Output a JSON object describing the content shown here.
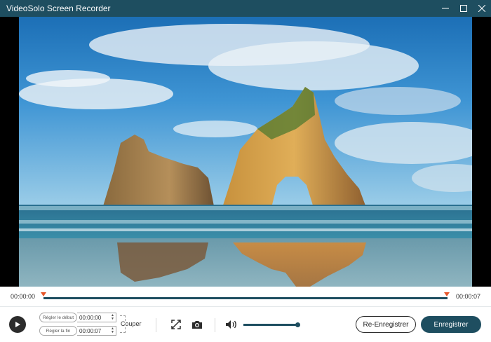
{
  "window": {
    "title": "VideoSolo Screen Recorder",
    "controls": [
      "minimize-icon",
      "maximize-icon",
      "close-icon"
    ]
  },
  "timeline": {
    "start_time": "00:00:00",
    "end_time": "00:00:07"
  },
  "trim": {
    "start_label": "Régler le début",
    "start_value": "00:00:00",
    "end_label": "Régler la fin",
    "end_value": "00:00:07",
    "cut_label": "Couper"
  },
  "toolbar": {
    "icons": [
      "play-icon",
      "fullscreen-icon",
      "camera-icon",
      "volume-icon"
    ],
    "volume_level": 1.0
  },
  "buttons": {
    "re_record": "Re-Enregistrer",
    "save": "Enregistrer"
  },
  "colors": {
    "titlebar": "#1e4e60",
    "accent": "#1e4e60",
    "marker": "#e7572a"
  }
}
